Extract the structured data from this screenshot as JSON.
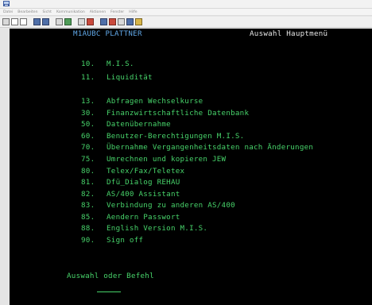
{
  "menubar": {
    "items": [
      "Datei",
      "Bearbeiten",
      "Sicht",
      "Kommunikation",
      "Aktionen",
      "Fenster",
      "Hilfe"
    ]
  },
  "toolbar": {
    "icons": [
      "print-icon",
      "copy-icon",
      "paste-icon",
      "send-icon",
      "receive-icon",
      "display-icon",
      "record-icon",
      "stop-icon",
      "play-icon",
      "macro-icon",
      "map-icon",
      "keyboard-icon",
      "color-icon",
      "customize-icon"
    ]
  },
  "terminal": {
    "header_left": "M1AUBC  PLATTNER",
    "header_right": "Auswahl Hauptmenü",
    "items": [
      {
        "num": "10.",
        "label": "M.I.S."
      },
      {
        "num": "11.",
        "label": "Liquidität"
      },
      {
        "num": "13.",
        "label": "Abfragen Wechselkurse"
      },
      {
        "num": "30.",
        "label": "Finanzwirtschaftliche Datenbank"
      },
      {
        "num": "50.",
        "label": "Datenübernahme"
      },
      {
        "num": "60.",
        "label": "Benutzer-Berechtigungen M.I.S."
      },
      {
        "num": "70.",
        "label": "Übernahme Vergangenheitsdaten nach Änderungen"
      },
      {
        "num": "75.",
        "label": "Umrechnen und kopieren JEW"
      },
      {
        "num": "80.",
        "label": "Telex/Fax/Teletex"
      },
      {
        "num": "81.",
        "label": "Dfü_Dialog REHAU"
      },
      {
        "num": "82.",
        "label": "AS/400 Assistant"
      },
      {
        "num": "83.",
        "label": "Verbindung zu anderen AS/400"
      },
      {
        "num": "85.",
        "label": "Aendern Passwort"
      },
      {
        "num": "88.",
        "label": "English Version M.I.S."
      },
      {
        "num": "90.",
        "label": "Sign off"
      }
    ],
    "prompt": "Auswahl oder Befehl"
  },
  "colors": {
    "terminal_bg": "#000000",
    "text_green": "#47d36a",
    "header_blue": "#61a8e8",
    "header_white": "#e6e6e6"
  }
}
